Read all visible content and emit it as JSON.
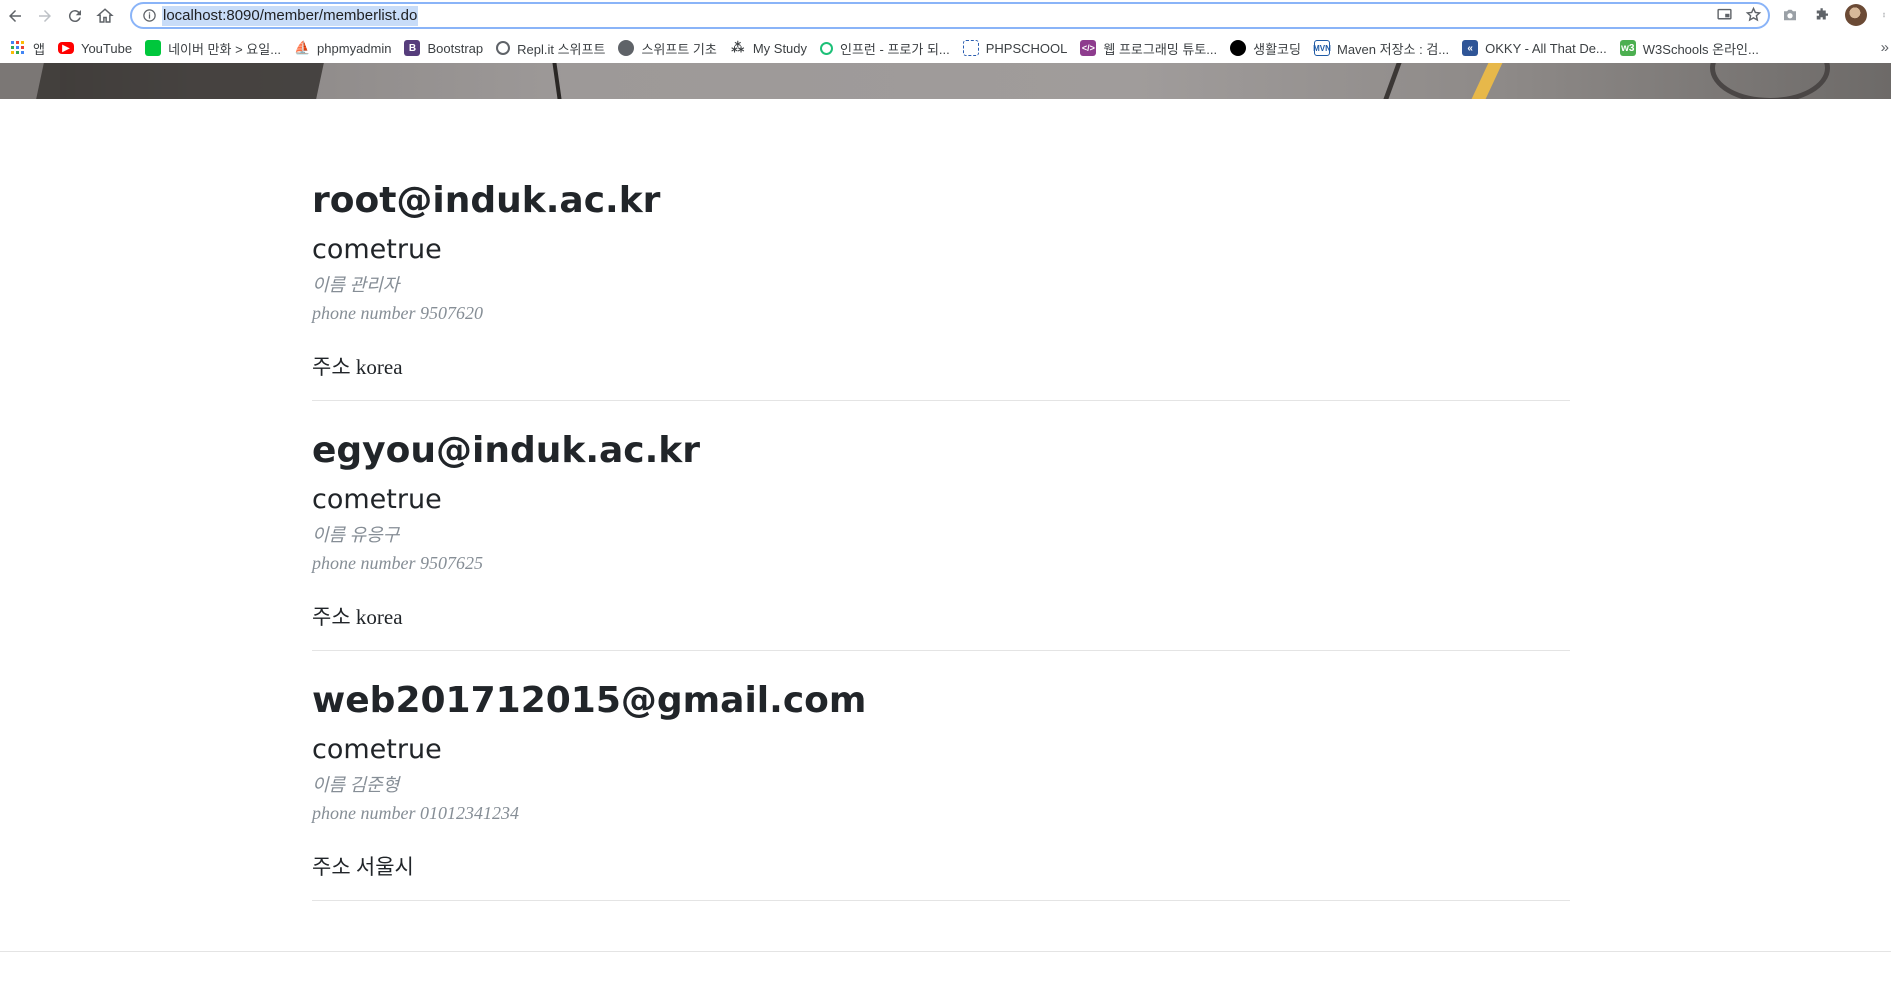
{
  "browser": {
    "url": "localhost:8090/member/memberlist.do",
    "bookmarks": [
      {
        "label": "앱",
        "icon": "apps-grid-icon",
        "color": "#4285f4"
      },
      {
        "label": "YouTube",
        "icon": "youtube-icon",
        "color": "#ff0000"
      },
      {
        "label": "네이버 만화 > 요일...",
        "icon": "naver-webtoon-icon",
        "color": "#00c73c"
      },
      {
        "label": "phpmyadmin",
        "icon": "phpmyadmin-icon",
        "color": "#f89c0e"
      },
      {
        "label": "Bootstrap",
        "icon": "bootstrap-icon",
        "color": "#563d7c"
      },
      {
        "label": "Repl.it 스위프트",
        "icon": "replit-icon",
        "color": "#5f6368"
      },
      {
        "label": "스위프트 기초",
        "icon": "globe-icon",
        "color": "#5f6368"
      },
      {
        "label": "My Study",
        "icon": "study-icon",
        "color": "#3c4043"
      },
      {
        "label": "인프런 - 프로가 되...",
        "icon": "inflearn-icon",
        "color": "#1dc078"
      },
      {
        "label": "PHPSCHOOL",
        "icon": "phpschool-icon",
        "color": "#2a5db0"
      },
      {
        "label": "웹 프로그래밍 튜토...",
        "icon": "web-tutorial-icon",
        "color": "#8e3c8e"
      },
      {
        "label": "생활코딩",
        "icon": "opentutorials-icon",
        "color": "#000000"
      },
      {
        "label": "Maven 저장소 : 검...",
        "icon": "maven-icon",
        "color": "#1f5aa5"
      },
      {
        "label": "OKKY - All That De...",
        "icon": "okky-icon",
        "color": "#2f5597"
      },
      {
        "label": "W3Schools 온라인...",
        "icon": "w3schools-icon",
        "color": "#4caf50"
      }
    ]
  },
  "members": [
    {
      "email": "root@induk.ac.kr",
      "password": "cometrue",
      "name_label": "이름 관리자",
      "phone_label": "phone number 9507620",
      "address_label": "주소 korea"
    },
    {
      "email": "egyou@induk.ac.kr",
      "password": "cometrue",
      "name_label": "이름 유응구",
      "phone_label": "phone number 9507625",
      "address_label": "주소 korea"
    },
    {
      "email": "web201712015@gmail.com",
      "password": "cometrue",
      "name_label": "이름 김준형",
      "phone_label": "phone number 01012341234",
      "address_label": "주소 서울시"
    }
  ]
}
